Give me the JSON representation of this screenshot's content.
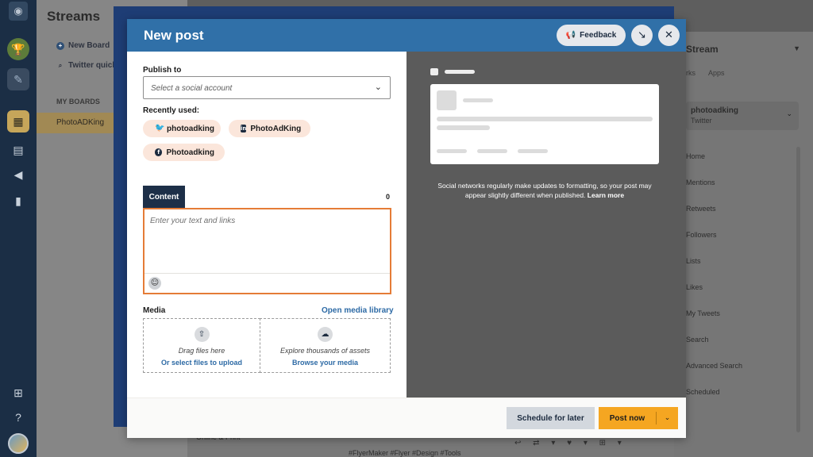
{
  "app": {
    "streams_title": "Streams",
    "new_board": "New Board",
    "twitter_quick": "Twitter quick",
    "my_boards": "MY BOARDS",
    "board_item": "PhotoADKing",
    "icons": {
      "rail": [
        "owl-logo-icon",
        "trophy-icon",
        "compose-icon",
        "streams-icon",
        "calendar-icon",
        "megaphone-icon",
        "analytics-icon",
        "apps-grid-icon",
        "help-icon",
        "avatar"
      ]
    }
  },
  "stream_column": {
    "header": "Stream",
    "tabs": [
      "rks",
      "Apps"
    ],
    "account_name": "photoadking",
    "account_network": "Twitter",
    "streams": [
      "Home",
      "Mentions",
      "Retweets",
      "Followers",
      "Lists",
      "Likes",
      "My Tweets",
      "Search",
      "Advanced Search",
      "Scheduled"
    ]
  },
  "background_feed": {
    "text1": "Online & Print",
    "text2": "#FlyerMaker #Flyer #Design #Tools"
  },
  "modal": {
    "title": "New post",
    "feedback_label": "Feedback",
    "publish_to_label": "Publish to",
    "account_placeholder": "Select a social account",
    "recently_used_label": "Recently used:",
    "recent_accounts": [
      {
        "network": "twitter",
        "icon": "twitter-icon",
        "label": "photoadking"
      },
      {
        "network": "linkedin",
        "icon": "linkedin-icon",
        "label": "PhotoAdKing"
      },
      {
        "network": "facebook",
        "icon": "facebook-icon",
        "label": "Photoadking"
      }
    ],
    "content_tab": "Content",
    "char_count": "0",
    "content_placeholder": "Enter your text and links",
    "media_label": "Media",
    "open_media_library": "Open media library",
    "upload_text": "Drag files here",
    "upload_link": "Or select files to upload",
    "browse_text": "Explore thousands of assets",
    "browse_link": "Browse your media",
    "preview_note": "Social networks regularly make updates to formatting, so your post may appear slightly different when published.",
    "learn_more": "Learn more",
    "schedule_label": "Schedule for later",
    "post_now_label": "Post now"
  },
  "colors": {
    "header_blue": "#3070a8",
    "post_orange": "#f5a621",
    "focus_orange": "#e57c37",
    "link_blue": "#2d6aa5",
    "chip_bg": "#fbe6db"
  }
}
